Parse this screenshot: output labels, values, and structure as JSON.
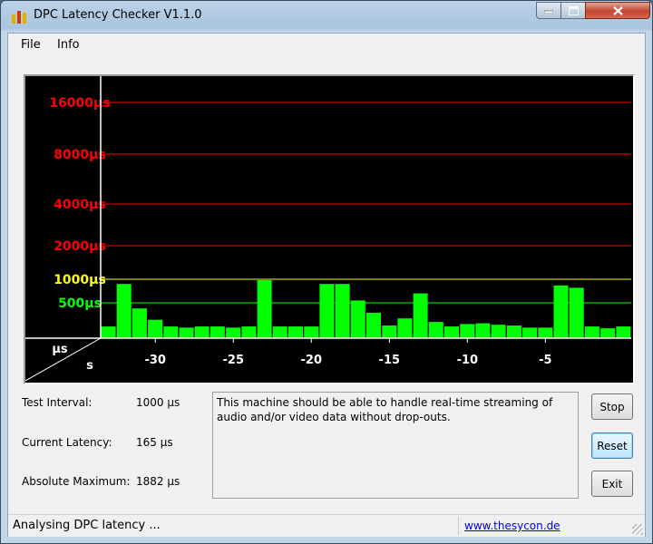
{
  "window": {
    "title": "DPC Latency Checker V1.1.0"
  },
  "menu": [
    "File",
    "Info"
  ],
  "chart_data": {
    "type": "bar",
    "y_scale": "log2",
    "ylabel": "µs",
    "xlabel": "s",
    "y_ticks": [
      {
        "label": "16000µs",
        "value": 16000,
        "color": "#ff0000"
      },
      {
        "label": "8000µs",
        "value": 8000,
        "color": "#ff0000"
      },
      {
        "label": "4000µs",
        "value": 4000,
        "color": "#ff0000"
      },
      {
        "label": "2000µs",
        "value": 2000,
        "color": "#ff0000"
      },
      {
        "label": "1000µs",
        "value": 1000,
        "color": "#ffff00"
      },
      {
        "label": "500µs",
        "value": 500,
        "color": "#00ff00"
      }
    ],
    "x_ticks": [
      "-30",
      "-25",
      "-20",
      "-15",
      "-10",
      "-5"
    ],
    "x_tick_values": [
      -30,
      -25,
      -20,
      -15,
      -10,
      -5
    ],
    "bar_color": "#00ff00",
    "x": [
      -33,
      -32,
      -31,
      -30,
      -29,
      -28,
      -27,
      -26,
      -25,
      -24,
      -23,
      -22,
      -21,
      -20,
      -19,
      -18,
      -17,
      -16,
      -15,
      -14,
      -13,
      -12,
      -11,
      -10,
      -9,
      -8,
      -7,
      -6,
      -5,
      -4,
      -3,
      -2,
      -1,
      0
    ],
    "values": [
      165,
      900,
      420,
      260,
      165,
      150,
      165,
      165,
      150,
      165,
      980,
      165,
      165,
      165,
      900,
      900,
      550,
      360,
      180,
      280,
      700,
      230,
      165,
      200,
      210,
      190,
      180,
      150,
      150,
      870,
      820,
      165,
      140,
      165
    ]
  },
  "info": {
    "test_interval_label": "Test Interval:",
    "test_interval_value": "1000 µs",
    "current_latency_label": "Current Latency:",
    "current_latency_value": "165 µs",
    "absolute_max_label": "Absolute Maximum:",
    "absolute_max_value": "1882 µs"
  },
  "message": "This machine should be able to handle real-time streaming of audio and/or video data without drop-outs.",
  "buttons": {
    "stop": "Stop",
    "reset": "Reset",
    "exit": "Exit"
  },
  "status": {
    "text": "Analysing DPC latency ...",
    "link": "www.thesycon.de"
  }
}
